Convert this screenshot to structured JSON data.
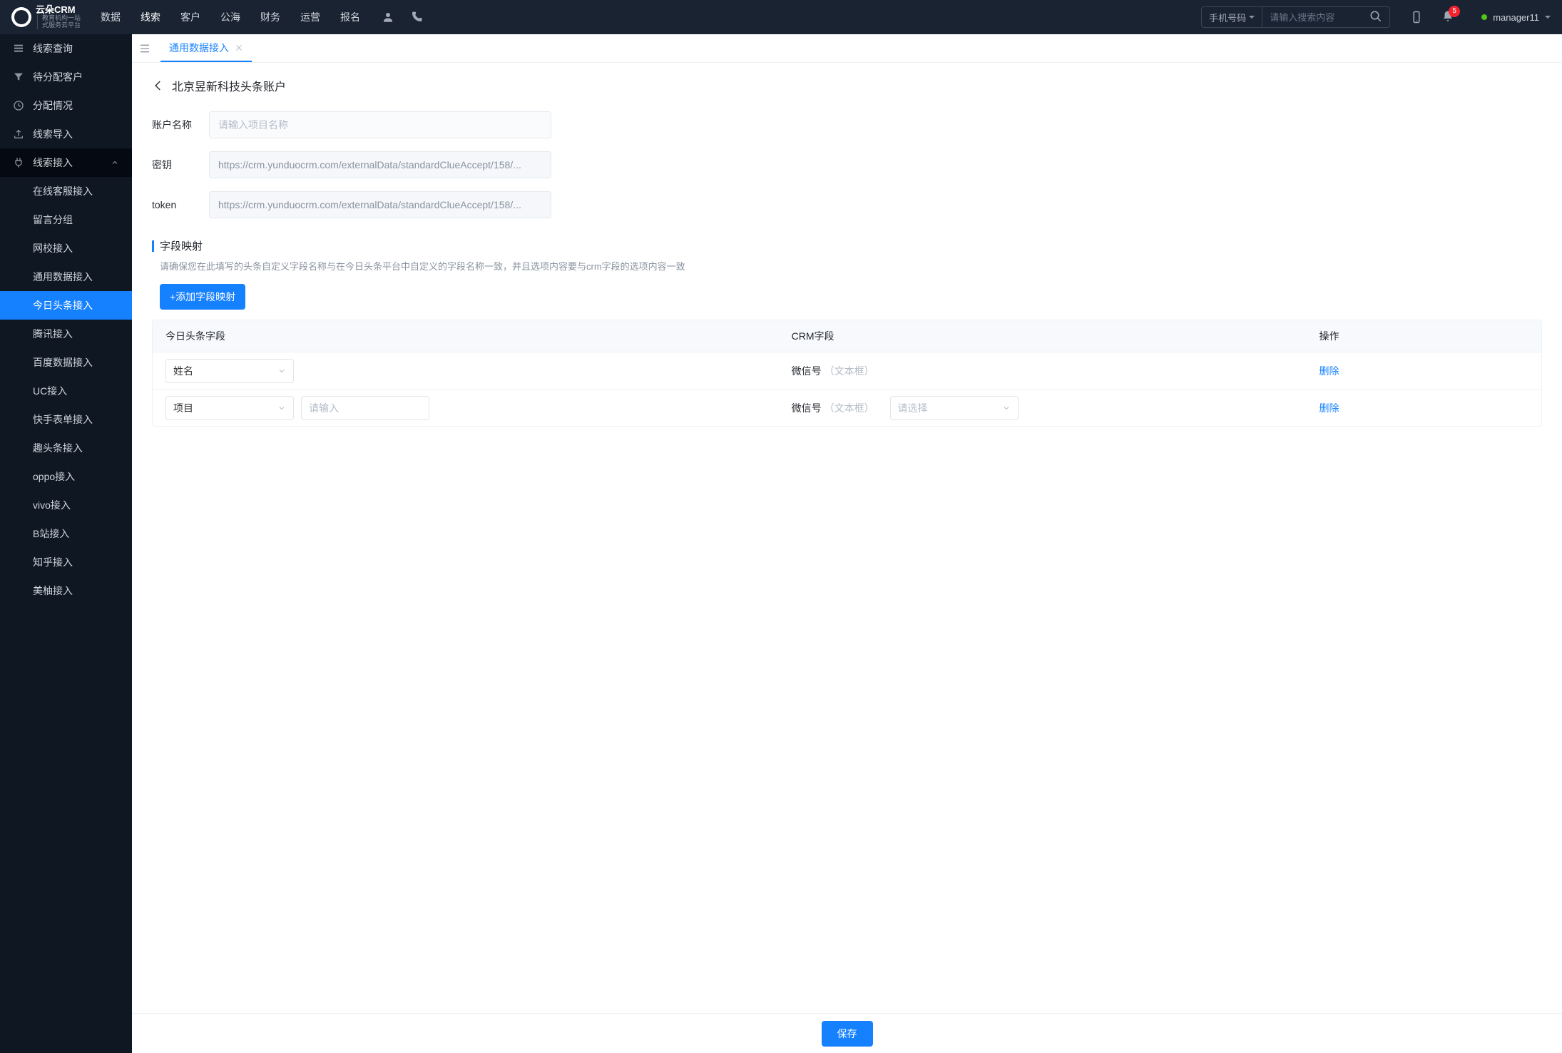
{
  "logo": {
    "brand": "云朵CRM",
    "subline1": "教育机构一站",
    "subline2": "式服务云平台"
  },
  "topnav": {
    "items": [
      "数据",
      "线索",
      "客户",
      "公海",
      "财务",
      "运营",
      "报名"
    ],
    "active_index": 1,
    "search_type": "手机号码",
    "search_placeholder": "请输入搜索内容",
    "notif_count": "5",
    "user": "manager11"
  },
  "sidebar": {
    "items": [
      {
        "label": "线索查询",
        "icon": "list-icon"
      },
      {
        "label": "待分配客户",
        "icon": "filter-icon"
      },
      {
        "label": "分配情况",
        "icon": "clock-icon"
      },
      {
        "label": "线索导入",
        "icon": "upload-icon"
      },
      {
        "label": "线索接入",
        "icon": "plug-icon",
        "expanded": true,
        "children": [
          "在线客服接入",
          "留言分组",
          "网校接入",
          "通用数据接入",
          "今日头条接入",
          "腾讯接入",
          "百度数据接入",
          "UC接入",
          "快手表单接入",
          "趣头条接入",
          "oppo接入",
          "vivo接入",
          "B站接入",
          "知乎接入",
          "美柚接入"
        ],
        "active_child_index": 4
      }
    ]
  },
  "tab": {
    "label": "通用数据接入"
  },
  "page": {
    "title": "北京昱新科技头条账户",
    "form": {
      "name_label": "账户名称",
      "name_placeholder": "请输入项目名称",
      "name_value": "",
      "secret_label": "密钥",
      "secret_value": "https://crm.yunduocrm.com/externalData/standardClueAccept/158/...",
      "token_label": "token",
      "token_value": "https://crm.yunduocrm.com/externalData/standardClueAccept/158/..."
    },
    "mapping": {
      "title": "字段映射",
      "desc": "请确保您在此填写的头条自定义字段名称与在今日头条平台中自定义的字段名称一致，并且选项内容要与crm字段的选项内容一致",
      "add_btn": "+添加字段映射",
      "columns": {
        "c1": "今日头条字段",
        "c2": "CRM字段",
        "c3": "操作"
      },
      "rows": [
        {
          "field_select": "姓名",
          "crm_label": "微信号",
          "crm_sub": "（文本框）",
          "action": "删除"
        },
        {
          "field_select": "项目",
          "extra_input_placeholder": "请输入",
          "crm_label": "微信号",
          "crm_sub": "（文本框）",
          "crm_select_placeholder": "请选择",
          "action": "删除"
        }
      ]
    },
    "save": "保存"
  }
}
